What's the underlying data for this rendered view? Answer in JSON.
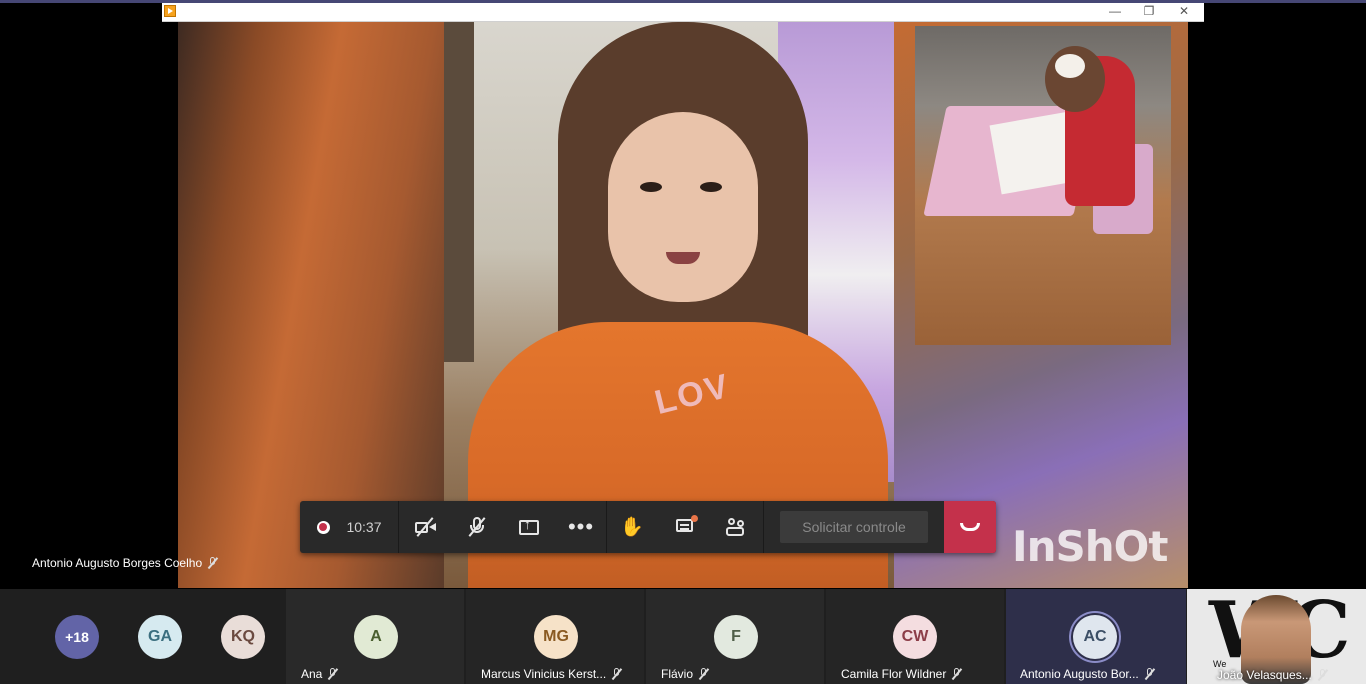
{
  "colors": {
    "accent": "#464775",
    "hangup": "#c4314b",
    "control_bar": "#292929",
    "gallery_bg": "#1f1f1f",
    "notification_dot": "#e97548"
  },
  "window": {
    "min_glyph": "—",
    "max_glyph": "❐",
    "close_glyph": "✕"
  },
  "video": {
    "watermark": "InShOt",
    "shirt_print": "LOV",
    "speaker_name": "Antonio Augusto Borges Coelho"
  },
  "controls": {
    "timer": "10:37",
    "more_glyph": "•••",
    "hand_glyph": "✋",
    "request_control": "Solicitar controle"
  },
  "gallery": {
    "overflow": "+18",
    "tiles": [
      {
        "initials": "GA",
        "name": "",
        "avatar_bg": "#d6eaf0",
        "avatar_fg": "#3c6f80"
      },
      {
        "initials": "KQ",
        "name": "",
        "avatar_bg": "#e9ddd8",
        "avatar_fg": "#6b4a40"
      },
      {
        "initials": "A",
        "name": "Ana",
        "avatar_bg": "#e1ead4",
        "avatar_fg": "#4a5f2e"
      },
      {
        "initials": "MG",
        "name": "Marcus Vinicius Kerst...",
        "avatar_bg": "#f6e2c8",
        "avatar_fg": "#8a5a21"
      },
      {
        "initials": "F",
        "name": "Flávio",
        "avatar_bg": "#e2e9df",
        "avatar_fg": "#4f5e48"
      },
      {
        "initials": "CW",
        "name": "Camila Flor Wildner",
        "avatar_bg": "#f4dde0",
        "avatar_fg": "#8c3d48"
      },
      {
        "initials": "AC",
        "name": "Antonio Augusto Bor...",
        "avatar_bg": "#dfe6ee",
        "avatar_fg": "#3c4f66"
      }
    ],
    "self": {
      "logo": "WC",
      "logo_sub": "We",
      "name": "João Velasques..."
    }
  }
}
